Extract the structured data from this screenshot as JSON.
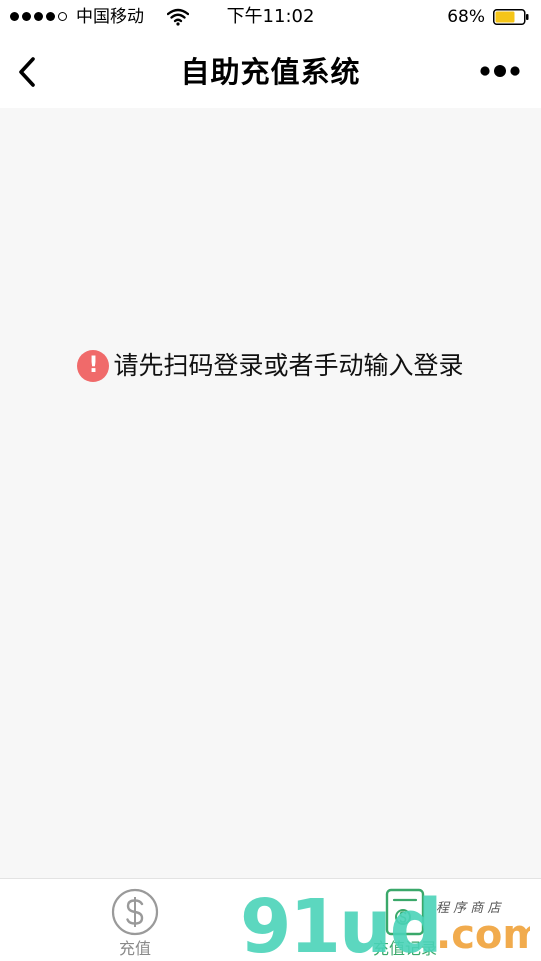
{
  "status_bar": {
    "carrier": "中国移动",
    "time": "下午11:02",
    "battery_percent": "68%",
    "battery_level": 0.68,
    "signal_bars_filled": 4,
    "signal_bars_total": 5,
    "battery_color": "#f5c518"
  },
  "nav": {
    "title": "自助充值系统",
    "back_icon": "chevron-left-icon",
    "more_icon": "more-dots-icon"
  },
  "notice": {
    "icon": "exclamation-circle-icon",
    "icon_glyph": "!",
    "icon_color": "#f06a6a",
    "text": "请先扫码登录或者手动输入登录"
  },
  "tabs": [
    {
      "label": "充值",
      "icon": "dollar-circle-icon",
      "active": false
    },
    {
      "label": "充值记录",
      "icon": "records-icon",
      "active": true,
      "color": "#3aa86a"
    }
  ],
  "watermark": {
    "brand": "91ud",
    "suffix": ".com",
    "tagline": "程 序 商 店",
    "brand_color": "#4ad3b8",
    "suffix_color": "#f0a23a"
  }
}
